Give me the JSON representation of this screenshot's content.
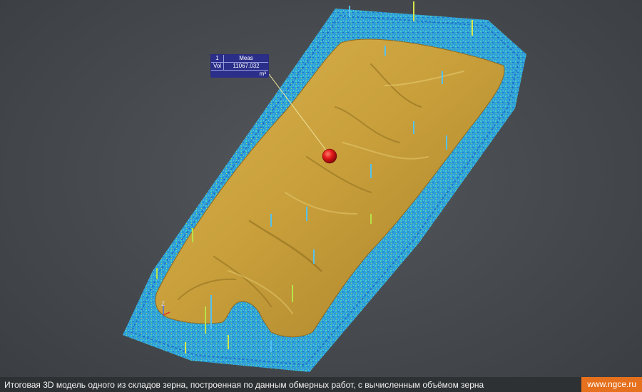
{
  "annotation": {
    "id": "1",
    "header": "Meas",
    "label": "Vol",
    "value": "11067.032",
    "unit": "m³"
  },
  "axis_label": "Z",
  "caption": {
    "text": "Итоговая 3D модель одного из складов зерна, построенная по данным обмерных работ, с вычисленным объёмом зерна",
    "url": "www.ngce.ru"
  },
  "colors": {
    "background": "#474b4f",
    "grain": "#c9a23e",
    "point_cloud": "#2aa8e8",
    "marker": "#d8161c",
    "caption_bar": "#2e3134",
    "url_badge": "#e5701d",
    "annotation_box": "#2b2f8a"
  }
}
